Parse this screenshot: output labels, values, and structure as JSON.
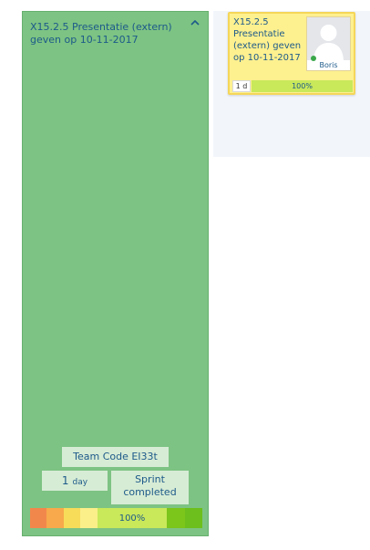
{
  "sprint": {
    "title": "X15.2.5 Presentatie (extern) geven op 10-11-2017",
    "team_code": "Team Code EI33t",
    "duration_value": "1",
    "duration_unit": "day",
    "status_line1": "Sprint",
    "status_line2": "completed",
    "progress_label": "100%",
    "progress_fraction": 1.0,
    "scale_colors": [
      "#f2874b",
      "#f7a94b",
      "#f7dc5a",
      "#fbef8a",
      "#7cc51b",
      "#6cbf1c"
    ]
  },
  "card": {
    "title": "X15.2.5 Presentatie (extern) geven op 10-11-2017",
    "assignee": "Boris",
    "duration": "1 d",
    "progress_label": "100%",
    "progress_fraction": 1.0,
    "background_color": "#fdf08f"
  }
}
